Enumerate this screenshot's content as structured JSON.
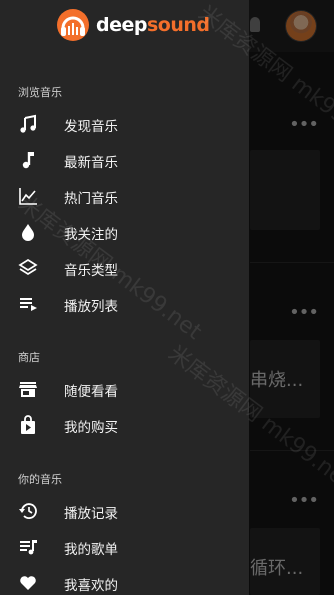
{
  "brand": {
    "part1": "deep",
    "part2": "sound",
    "accent": "#f36f2b"
  },
  "drawer": {
    "sections": [
      {
        "title": "浏览音乐",
        "items": [
          {
            "label": "发现音乐",
            "icon": "music-note-icon"
          },
          {
            "label": "最新音乐",
            "icon": "single-note-icon"
          },
          {
            "label": "热门音乐",
            "icon": "trending-chart-icon"
          },
          {
            "label": "我关注的",
            "icon": "drop-icon"
          },
          {
            "label": "音乐类型",
            "icon": "layers-icon"
          },
          {
            "label": "播放列表",
            "icon": "playlist-icon"
          }
        ]
      },
      {
        "title": "商店",
        "items": [
          {
            "label": "随便看看",
            "icon": "store-icon"
          },
          {
            "label": "我的购买",
            "icon": "shopping-bag-icon"
          }
        ]
      },
      {
        "title": "你的音乐",
        "items": [
          {
            "label": "播放记录",
            "icon": "history-icon"
          },
          {
            "label": "我的歌单",
            "icon": "queue-music-icon"
          },
          {
            "label": "我喜欢的",
            "icon": "heart-icon"
          }
        ]
      }
    ]
  },
  "background": {
    "card1_text": "串烧...",
    "card2_text": "循环..."
  },
  "watermark": "米库资源网 mk99.net"
}
